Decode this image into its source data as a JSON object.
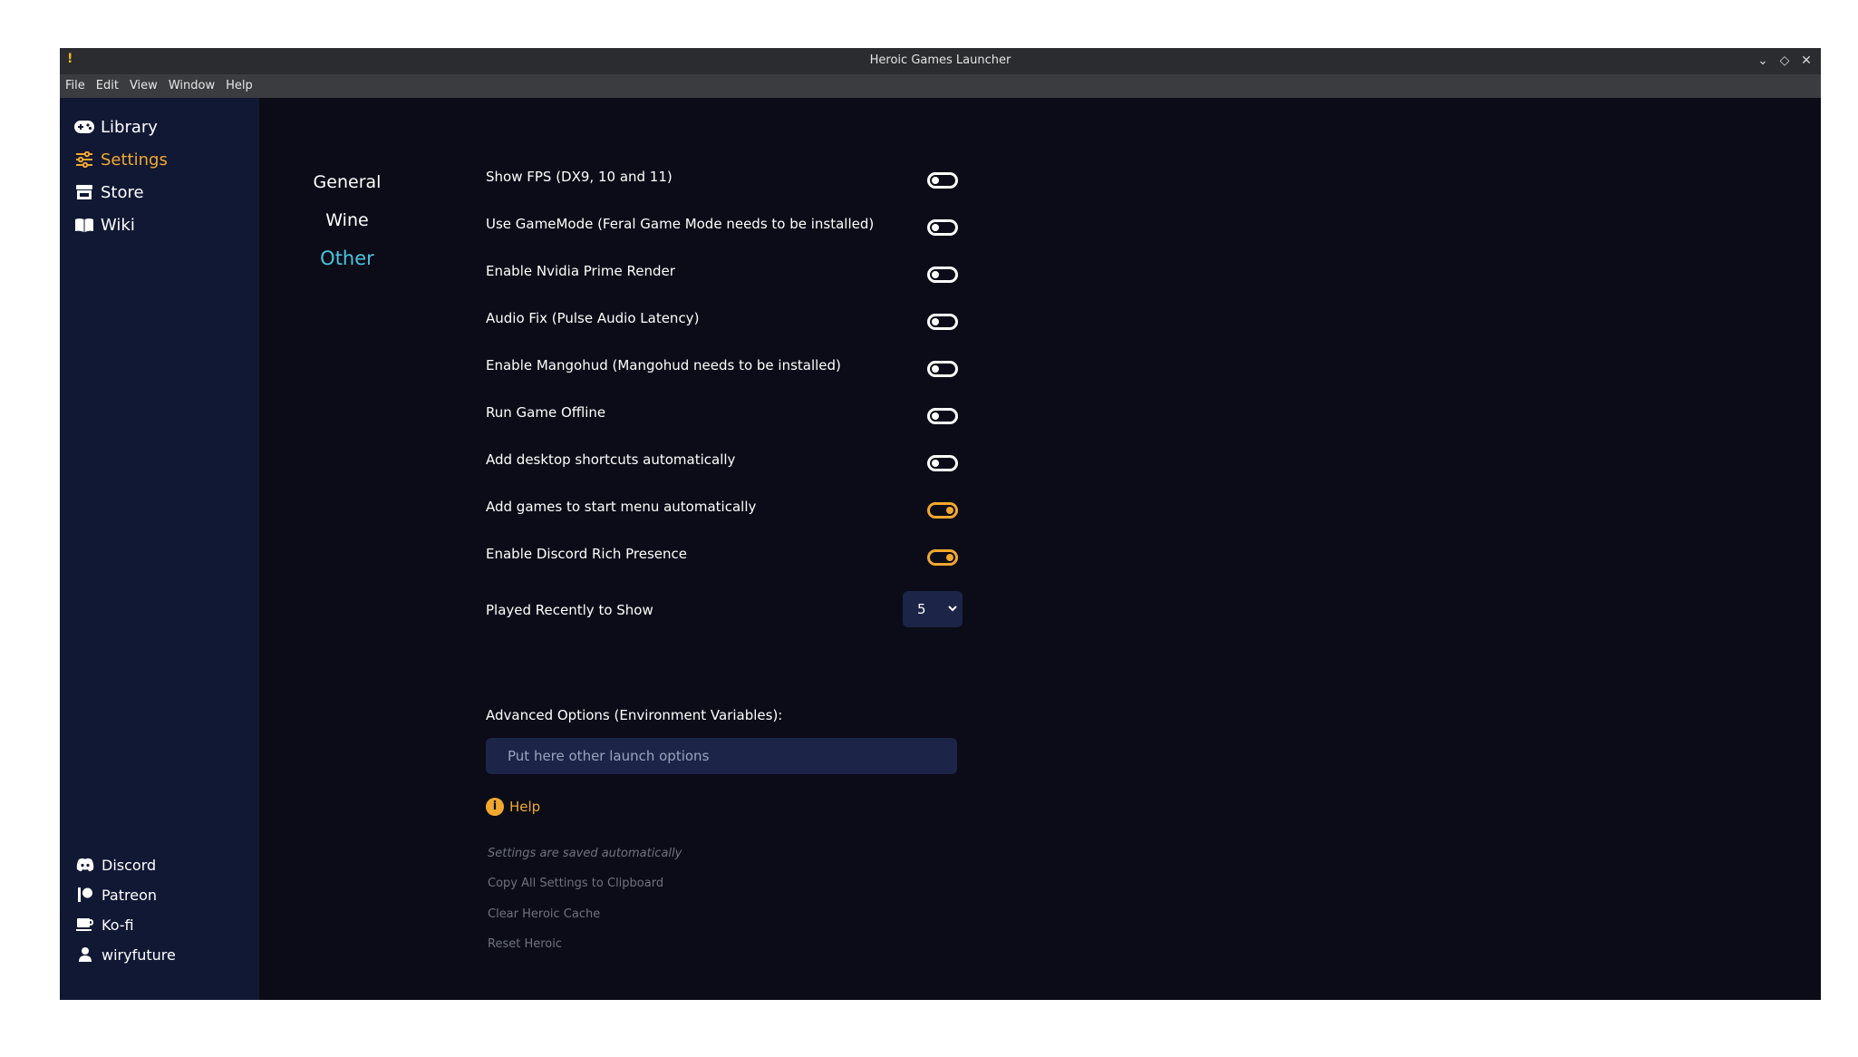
{
  "window": {
    "title": "Heroic Games Launcher",
    "icon_glyph": "!",
    "controls": {
      "minimize": "⌄",
      "maximize": "◇",
      "close": "✕"
    }
  },
  "menubar": {
    "items": [
      "File",
      "Edit",
      "View",
      "Window",
      "Help"
    ]
  },
  "sidebar": {
    "nav": [
      {
        "label": "Library",
        "icon": "gamepad-icon"
      },
      {
        "label": "Settings",
        "icon": "sliders-icon",
        "active": true
      },
      {
        "label": "Store",
        "icon": "store-icon"
      },
      {
        "label": "Wiki",
        "icon": "book-icon"
      }
    ],
    "external": [
      {
        "label": "Discord",
        "icon": "discord-icon"
      },
      {
        "label": "Patreon",
        "icon": "patreon-icon"
      },
      {
        "label": "Ko-fi",
        "icon": "kofi-cup-icon"
      },
      {
        "label": "wiryfuture",
        "icon": "user-icon"
      }
    ]
  },
  "settings_tabs": [
    {
      "label": "General"
    },
    {
      "label": "Wine"
    },
    {
      "label": "Other",
      "active": true
    }
  ],
  "options": [
    {
      "label": "Show FPS (DX9, 10 and 11)",
      "enabled": false
    },
    {
      "label": "Use GameMode (Feral Game Mode needs to be installed)",
      "enabled": false
    },
    {
      "label": "Enable Nvidia Prime Render",
      "enabled": false
    },
    {
      "label": "Audio Fix (Pulse Audio Latency)",
      "enabled": false
    },
    {
      "label": "Enable Mangohud (Mangohud needs to be installed)",
      "enabled": false
    },
    {
      "label": "Run Game Offline",
      "enabled": false
    },
    {
      "label": "Add desktop shortcuts automatically",
      "enabled": false
    },
    {
      "label": "Add games to start menu automatically",
      "enabled": true
    },
    {
      "label": "Enable Discord Rich Presence",
      "enabled": true
    }
  ],
  "played_recently": {
    "label": "Played Recently to Show",
    "value": "5"
  },
  "advanced": {
    "label": "Advanced Options (Environment Variables):",
    "placeholder": "Put here other launch options",
    "value": ""
  },
  "help": {
    "label": "Help",
    "icon_glyph": "i"
  },
  "footer": {
    "saved_note": "Settings are saved automatically",
    "copy_label": "Copy All Settings to Clipboard",
    "clear_cache_label": "Clear Heroic Cache",
    "reset_label": "Reset Heroic"
  },
  "colors": {
    "accent": "#f2a82e",
    "active_tab": "#4dc3e0",
    "sidebar_bg": "#111834",
    "content_bg": "#0b0c17",
    "input_bg": "#1c2548"
  }
}
